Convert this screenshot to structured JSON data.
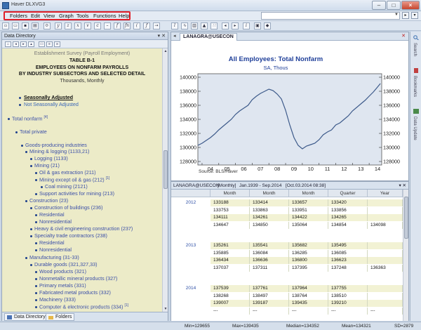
{
  "window": {
    "title": "Haver DLXVG3"
  },
  "menu": [
    "Folders",
    "Edit",
    "View",
    "Graph",
    "Tools",
    "Functions",
    "Help"
  ],
  "left_panel": {
    "title": "Data Directory",
    "header_lines": {
      "survey": "Establishment Survey (Payroll Employment)",
      "table": "TABLE B-1",
      "line1": "EMPLOYEES ON NONFARM PAYROLLS",
      "line2": "BY INDUSTRY SUBSECTORS AND SELECTED DETAIL",
      "units": "Thousands, Monthly"
    },
    "sa": "Seasonally Adjusted",
    "nsa": "Not Seasonally Adjusted",
    "tree": [
      {
        "label": "Total nonfarm",
        "fn": "[4]"
      },
      {
        "label": "Total private",
        "fn": ""
      },
      {
        "label": "Goods-producing industries",
        "fn": ""
      },
      {
        "label": "Mining & logging (1133,21)",
        "fn": ""
      },
      {
        "label": "Logging (1133)",
        "fn": ""
      },
      {
        "label": "Mining (21)",
        "fn": ""
      },
      {
        "label": "Oil & gas extraction (211)",
        "fn": ""
      },
      {
        "label": "Mining except oil & gas (212)",
        "fn": "[1]"
      },
      {
        "label": "Coal mining (2121)",
        "fn": ""
      },
      {
        "label": "Support activities for mining (213)",
        "fn": ""
      },
      {
        "label": "Construction (23)",
        "fn": ""
      },
      {
        "label": "Construction of buildings (236)",
        "fn": ""
      },
      {
        "label": "Residential",
        "fn": ""
      },
      {
        "label": "Nonresidential",
        "fn": ""
      },
      {
        "label": "Heavy & civil engineering construction (237)",
        "fn": ""
      },
      {
        "label": "Specialty trade contractors (238)",
        "fn": ""
      },
      {
        "label": "Residential",
        "fn": ""
      },
      {
        "label": "Nonresidential",
        "fn": ""
      },
      {
        "label": "Manufacturing (31-33)",
        "fn": ""
      },
      {
        "label": "Durable goods (321,327,33)",
        "fn": ""
      },
      {
        "label": "Wood products (321)",
        "fn": ""
      },
      {
        "label": "Nonmetallic mineral products (327)",
        "fn": ""
      },
      {
        "label": "Primary metals (331)",
        "fn": ""
      },
      {
        "label": "Fabricated metal products (332)",
        "fn": ""
      },
      {
        "label": "Machinery (333)",
        "fn": ""
      },
      {
        "label": "Computer & electronic products (334)",
        "fn": "[1]"
      }
    ],
    "tabs": [
      "Data Directory",
      "Folders"
    ]
  },
  "chart_tab": {
    "label": "LANAGRA@USECON"
  },
  "chart_data": {
    "type": "line",
    "title": "All Employees: Total Nonfarm",
    "subtitle": "SA, Thous",
    "source": "Source:  BLS/Haver",
    "x_ticks": [
      "04",
      "05",
      "06",
      "07",
      "08",
      "09",
      "10",
      "11",
      "12",
      "13",
      "14"
    ],
    "y_ticks": [
      128000,
      130000,
      132000,
      134000,
      136000,
      138000,
      140000
    ],
    "ylim": [
      127500,
      140500
    ],
    "xlim": [
      2003.75,
      2014.75
    ],
    "x": [
      2003.75,
      2004.0,
      2004.25,
      2004.5,
      2004.75,
      2005.0,
      2005.25,
      2005.5,
      2005.75,
      2006.0,
      2006.25,
      2006.5,
      2006.75,
      2007.0,
      2007.25,
      2007.5,
      2007.75,
      2008.0,
      2008.25,
      2008.5,
      2008.75,
      2009.0,
      2009.25,
      2009.5,
      2009.75,
      2010.0,
      2010.25,
      2010.5,
      2010.75,
      2011.0,
      2011.25,
      2011.5,
      2011.75,
      2012.0,
      2012.25,
      2012.5,
      2012.75,
      2013.0,
      2013.25,
      2013.5,
      2013.75,
      2014.0,
      2014.25,
      2014.5,
      2014.67
    ],
    "series": [
      {
        "values": [
          130300,
          130600,
          131000,
          131400,
          131900,
          132500,
          133000,
          133500,
          134000,
          134700,
          135200,
          135600,
          136000,
          136800,
          137300,
          137700,
          138000,
          138300,
          138100,
          137600,
          136900,
          135300,
          133200,
          131400,
          130300,
          129800,
          130200,
          130400,
          130600,
          131100,
          131800,
          132200,
          132500,
          133200,
          133500,
          134000,
          134500,
          135200,
          135700,
          136200,
          136700,
          137300,
          137900,
          138600,
          139100
        ]
      }
    ]
  },
  "table_bar": {
    "series": "LANAGRA@USECON",
    "freq": "[Monthly]",
    "range": "Jan.1939 - Sep.2014",
    "stamp": "[Oct.03.2014 08:38]"
  },
  "table": {
    "columns": [
      "Month",
      "Month",
      "Month",
      "Quarter",
      "Year"
    ],
    "groups": [
      {
        "year": "2012",
        "rows": [
          [
            "133188",
            "133414",
            "133657",
            "133420",
            ""
          ],
          [
            "133753",
            "133863",
            "133951",
            "133856",
            ""
          ],
          [
            "134111",
            "134261",
            "134422",
            "134265",
            ""
          ],
          [
            "134647",
            "134850",
            "135064",
            "134854",
            "134098"
          ]
        ]
      },
      {
        "year": "2013",
        "rows": [
          [
            "135261",
            "135541",
            "135682",
            "135495",
            ""
          ],
          [
            "135885",
            "136084",
            "136285",
            "136085",
            ""
          ],
          [
            "136434",
            "136636",
            "136800",
            "136623",
            ""
          ],
          [
            "137037",
            "137311",
            "137395",
            "137248",
            "136363"
          ]
        ]
      },
      {
        "year": "2014",
        "rows": [
          [
            "137539",
            "137761",
            "137964",
            "137755",
            ""
          ],
          [
            "138268",
            "138497",
            "138764",
            "138510",
            ""
          ],
          [
            "139007",
            "139187",
            "139435",
            "139210",
            ""
          ],
          [
            "---",
            "---",
            "---",
            "---",
            "---"
          ]
        ]
      }
    ]
  },
  "right_strip": [
    "Search",
    "Bookmarks",
    "Data Update"
  ],
  "status": {
    "min": "Min=129655",
    "max": "Max=139435",
    "median": "Median=134352",
    "mean": "Mean=134321",
    "sd": "SD=2879"
  },
  "colors": {
    "line": "#3d5a8a",
    "plot_bg": "#dfe6f0",
    "title": "#1f3f99",
    "highlight": "#e0202a"
  }
}
